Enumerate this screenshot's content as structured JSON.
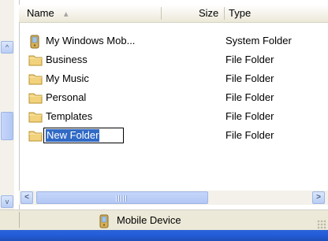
{
  "header": {
    "name_label": "Name",
    "sort_arrow": "▲",
    "size_label": "Size",
    "type_label": "Type"
  },
  "rows": [
    {
      "name": "My Windows Mob...",
      "type": "System Folder",
      "icon": "mobile-device-icon"
    },
    {
      "name": "Business",
      "type": "File Folder",
      "icon": "folder-icon"
    },
    {
      "name": "My Music",
      "type": "File Folder",
      "icon": "folder-icon"
    },
    {
      "name": "Personal",
      "type": "File Folder",
      "icon": "folder-icon"
    },
    {
      "name": "Templates",
      "type": "File Folder",
      "icon": "folder-icon"
    },
    {
      "name": "New Folder",
      "type": "File Folder",
      "icon": "folder-icon",
      "editing": true
    }
  ],
  "scrollbar": {
    "left_arrow": "<",
    "right_arrow": ">",
    "up_arrow": "^",
    "down_arrow": "v"
  },
  "status": {
    "label": "Mobile Device",
    "icon": "mobile-device-icon"
  },
  "colors": {
    "selection": "#316ac5",
    "folder": "#f2d27c",
    "taskbar": "#245edb"
  }
}
